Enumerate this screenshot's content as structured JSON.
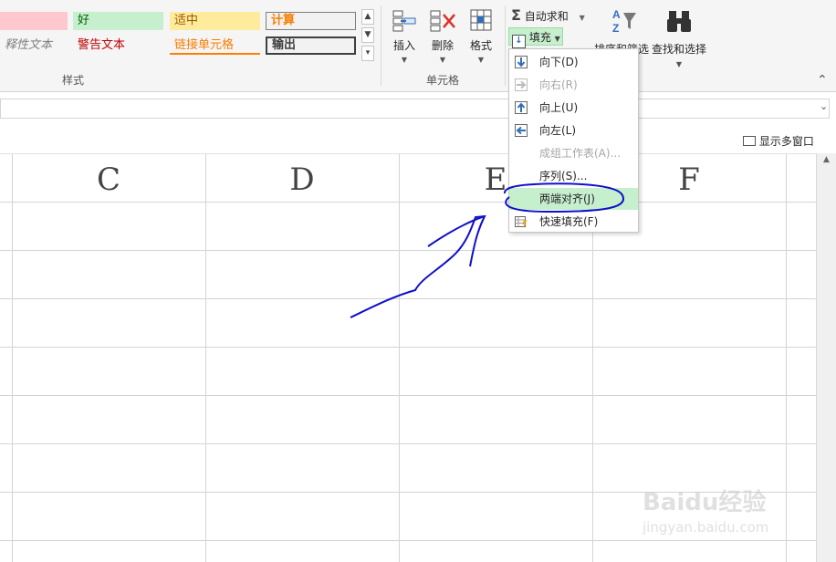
{
  "styles": {
    "explain_text": "释性文本",
    "bad": "",
    "good": "好",
    "neutral": "适中",
    "calculation": "计算",
    "warning_text": "警告文本",
    "linked_cell": "链接单元格",
    "output": "输出",
    "group_label": "样式"
  },
  "cells": {
    "insert": "插入",
    "delete": "删除",
    "format": "格式",
    "group_label": "单元格"
  },
  "editing": {
    "autosum": "自动求和",
    "fill": "填充",
    "sort_filter": "排序和筛选",
    "find_select": "查找和选择"
  },
  "window": {
    "multi_window": "显示多窗口"
  },
  "columns": [
    "C",
    "D",
    "E",
    "F"
  ],
  "fill_menu": {
    "items": [
      {
        "label": "向下(D)",
        "enabled": true,
        "icon": "arrow-down-icon"
      },
      {
        "label": "向右(R)",
        "enabled": false,
        "icon": "arrow-right-icon"
      },
      {
        "label": "向上(U)",
        "enabled": true,
        "icon": "arrow-up-icon"
      },
      {
        "label": "向左(L)",
        "enabled": true,
        "icon": "arrow-left-icon"
      },
      {
        "label": "成组工作表(A)...",
        "enabled": false,
        "icon": ""
      },
      {
        "label": "序列(S)...",
        "enabled": true,
        "icon": ""
      },
      {
        "label": "两端对齐(J)",
        "enabled": true,
        "icon": "",
        "highlighted": true
      },
      {
        "label": "快速填充(F)",
        "enabled": true,
        "icon": "flash-fill-icon"
      }
    ]
  },
  "watermark": {
    "brand": "Baidu经验",
    "url": "jingyan.baidu.com"
  },
  "colors": {
    "annotation": "#1010c8",
    "menu_highlight": "#c6efce",
    "icon_blue": "#2f6fba"
  }
}
